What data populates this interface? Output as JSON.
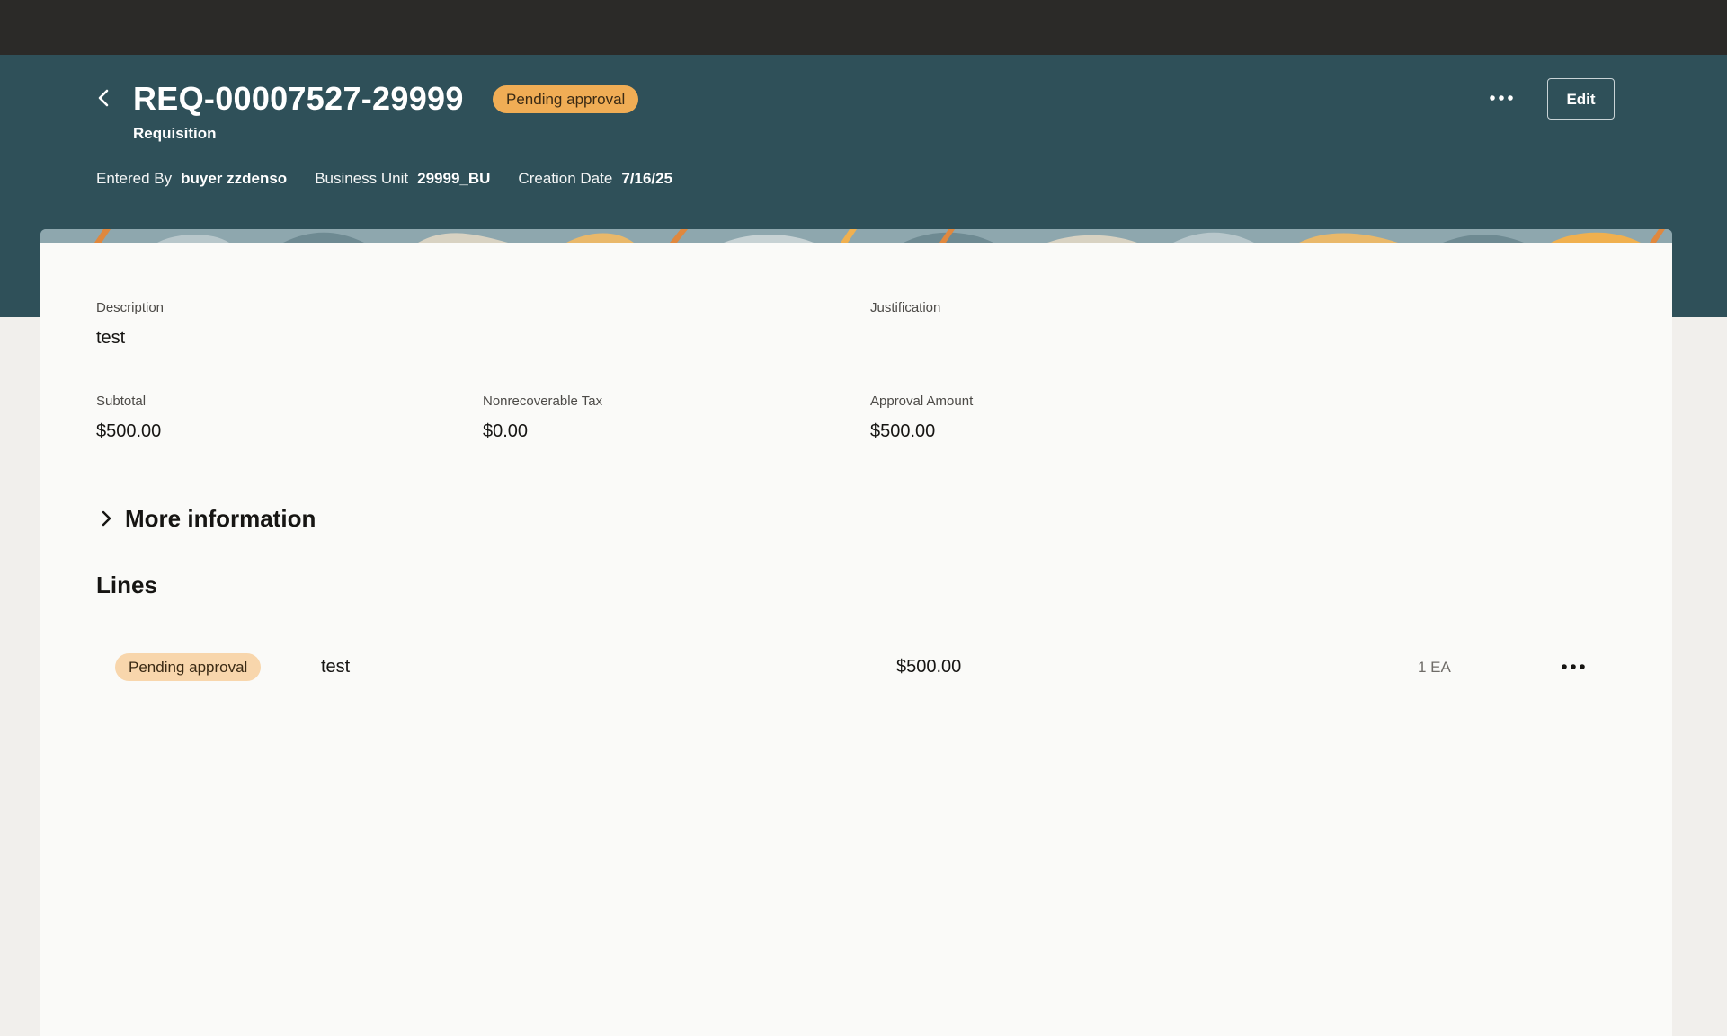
{
  "header": {
    "title": "REQ-00007527-29999",
    "status_badge": "Pending approval",
    "subtitle": "Requisition",
    "meta": [
      {
        "label": "Entered By",
        "value": "buyer zzdenso"
      },
      {
        "label": "Business Unit",
        "value": "29999_BU"
      },
      {
        "label": "Creation Date",
        "value": "7/16/25"
      }
    ],
    "edit_label": "Edit",
    "back_icon": "chevron-left-icon",
    "more_icon": "ellipsis-icon"
  },
  "details": {
    "description_label": "Description",
    "description_value": "test",
    "justification_label": "Justification",
    "justification_value": "",
    "subtotal_label": "Subtotal",
    "subtotal_value": "$500.00",
    "tax_label": "Nonrecoverable Tax",
    "tax_value": "$0.00",
    "approval_label": "Approval Amount",
    "approval_value": "$500.00"
  },
  "more_info": {
    "label": "More information",
    "icon": "chevron-right-icon"
  },
  "lines": {
    "title": "Lines",
    "items": [
      {
        "status": "Pending approval",
        "description": "test",
        "amount": "$500.00",
        "quantity": "1 EA"
      }
    ]
  },
  "colors": {
    "topbar": "#2b2a28",
    "header": "#2f5059",
    "badge": "#f0ad55",
    "line_badge": "#f8d6ac",
    "panel": "#fafaf8",
    "page": "#f1efec"
  }
}
